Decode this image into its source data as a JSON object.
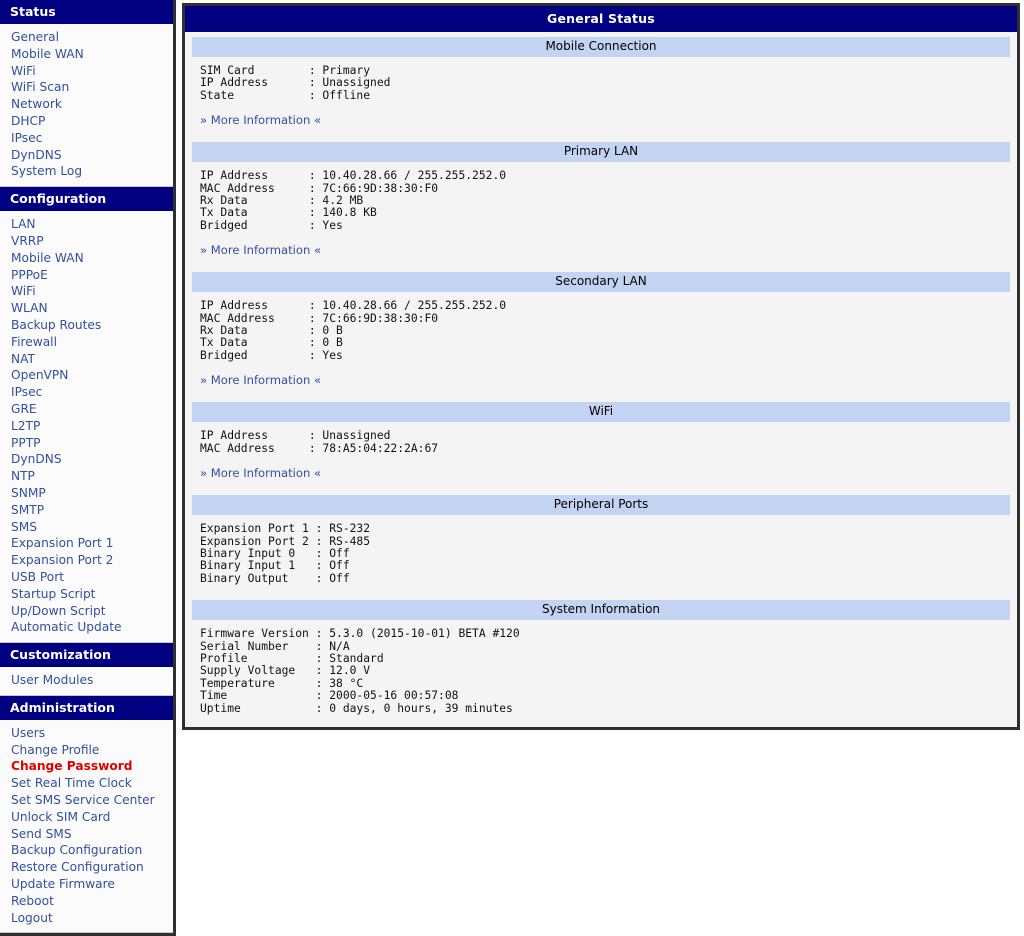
{
  "sidebar": {
    "groups": [
      {
        "header": "Status",
        "items": [
          {
            "label": "General",
            "current": false
          },
          {
            "label": "Mobile WAN",
            "current": false
          },
          {
            "label": "WiFi",
            "current": false
          },
          {
            "label": "WiFi Scan",
            "current": false
          },
          {
            "label": "Network",
            "current": false
          },
          {
            "label": "DHCP",
            "current": false
          },
          {
            "label": "IPsec",
            "current": false
          },
          {
            "label": "DynDNS",
            "current": false
          },
          {
            "label": "System Log",
            "current": false
          }
        ]
      },
      {
        "header": "Configuration",
        "items": [
          {
            "label": "LAN",
            "current": false
          },
          {
            "label": "VRRP",
            "current": false
          },
          {
            "label": "Mobile WAN",
            "current": false
          },
          {
            "label": "PPPoE",
            "current": false
          },
          {
            "label": "WiFi",
            "current": false
          },
          {
            "label": "WLAN",
            "current": false
          },
          {
            "label": "Backup Routes",
            "current": false
          },
          {
            "label": "Firewall",
            "current": false
          },
          {
            "label": "NAT",
            "current": false
          },
          {
            "label": "OpenVPN",
            "current": false
          },
          {
            "label": "IPsec",
            "current": false
          },
          {
            "label": "GRE",
            "current": false
          },
          {
            "label": "L2TP",
            "current": false
          },
          {
            "label": "PPTP",
            "current": false
          },
          {
            "label": "DynDNS",
            "current": false
          },
          {
            "label": "NTP",
            "current": false
          },
          {
            "label": "SNMP",
            "current": false
          },
          {
            "label": "SMTP",
            "current": false
          },
          {
            "label": "SMS",
            "current": false
          },
          {
            "label": "Expansion Port 1",
            "current": false
          },
          {
            "label": "Expansion Port 2",
            "current": false
          },
          {
            "label": "USB Port",
            "current": false
          },
          {
            "label": "Startup Script",
            "current": false
          },
          {
            "label": "Up/Down Script",
            "current": false
          },
          {
            "label": "Automatic Update",
            "current": false
          }
        ]
      },
      {
        "header": "Customization",
        "items": [
          {
            "label": "User Modules",
            "current": false
          }
        ]
      },
      {
        "header": "Administration",
        "items": [
          {
            "label": "Users",
            "current": false
          },
          {
            "label": "Change Profile",
            "current": false
          },
          {
            "label": "Change Password",
            "current": true
          },
          {
            "label": "Set Real Time Clock",
            "current": false
          },
          {
            "label": "Set SMS Service Center",
            "current": false
          },
          {
            "label": "Unlock SIM Card",
            "current": false
          },
          {
            "label": "Send SMS",
            "current": false
          },
          {
            "label": "Backup Configuration",
            "current": false
          },
          {
            "label": "Restore Configuration",
            "current": false
          },
          {
            "label": "Update Firmware",
            "current": false
          },
          {
            "label": "Reboot",
            "current": false
          },
          {
            "label": "Logout",
            "current": false
          }
        ]
      }
    ]
  },
  "main": {
    "title": "General Status",
    "more_information_label": "» More Information «",
    "sections": [
      {
        "header": "Mobile Connection",
        "rows": [
          "SIM Card        : Primary",
          "IP Address      : Unassigned",
          "State           : Offline"
        ],
        "has_more": true
      },
      {
        "header": "Primary LAN",
        "rows": [
          "IP Address      : 10.40.28.66 / 255.255.252.0",
          "MAC Address     : 7C:66:9D:38:30:F0",
          "Rx Data         : 4.2 MB",
          "Tx Data         : 140.8 KB",
          "Bridged         : Yes"
        ],
        "has_more": true
      },
      {
        "header": "Secondary LAN",
        "rows": [
          "IP Address      : 10.40.28.66 / 255.255.252.0",
          "MAC Address     : 7C:66:9D:38:30:F0",
          "Rx Data         : 0 B",
          "Tx Data         : 0 B",
          "Bridged         : Yes"
        ],
        "has_more": true
      },
      {
        "header": "WiFi",
        "rows": [
          "IP Address      : Unassigned",
          "MAC Address     : 78:A5:04:22:2A:67"
        ],
        "has_more": true
      },
      {
        "header": "Peripheral Ports",
        "rows": [
          "Expansion Port 1 : RS-232",
          "Expansion Port 2 : RS-485",
          "Binary Input 0   : Off",
          "Binary Input 1   : Off",
          "Binary Output    : Off"
        ],
        "has_more": false
      },
      {
        "header": "System Information",
        "rows": [
          "Firmware Version : 5.3.0 (2015-10-01) BETA #120",
          "Serial Number    : N/A",
          "Profile          : Standard",
          "Supply Voltage   : 12.0 V",
          "Temperature      : 38 °C",
          "Time             : 2000-05-16 00:57:08",
          "Uptime           : 0 days, 0 hours, 39 minutes"
        ],
        "has_more": false
      }
    ]
  },
  "colors": {
    "header_blue": "#000080",
    "section_blue": "#c3d4f2",
    "link_blue": "#3350a0",
    "current_red": "#e00000",
    "panel_bg": "#f4f4f4",
    "border_dark": "#303030"
  }
}
